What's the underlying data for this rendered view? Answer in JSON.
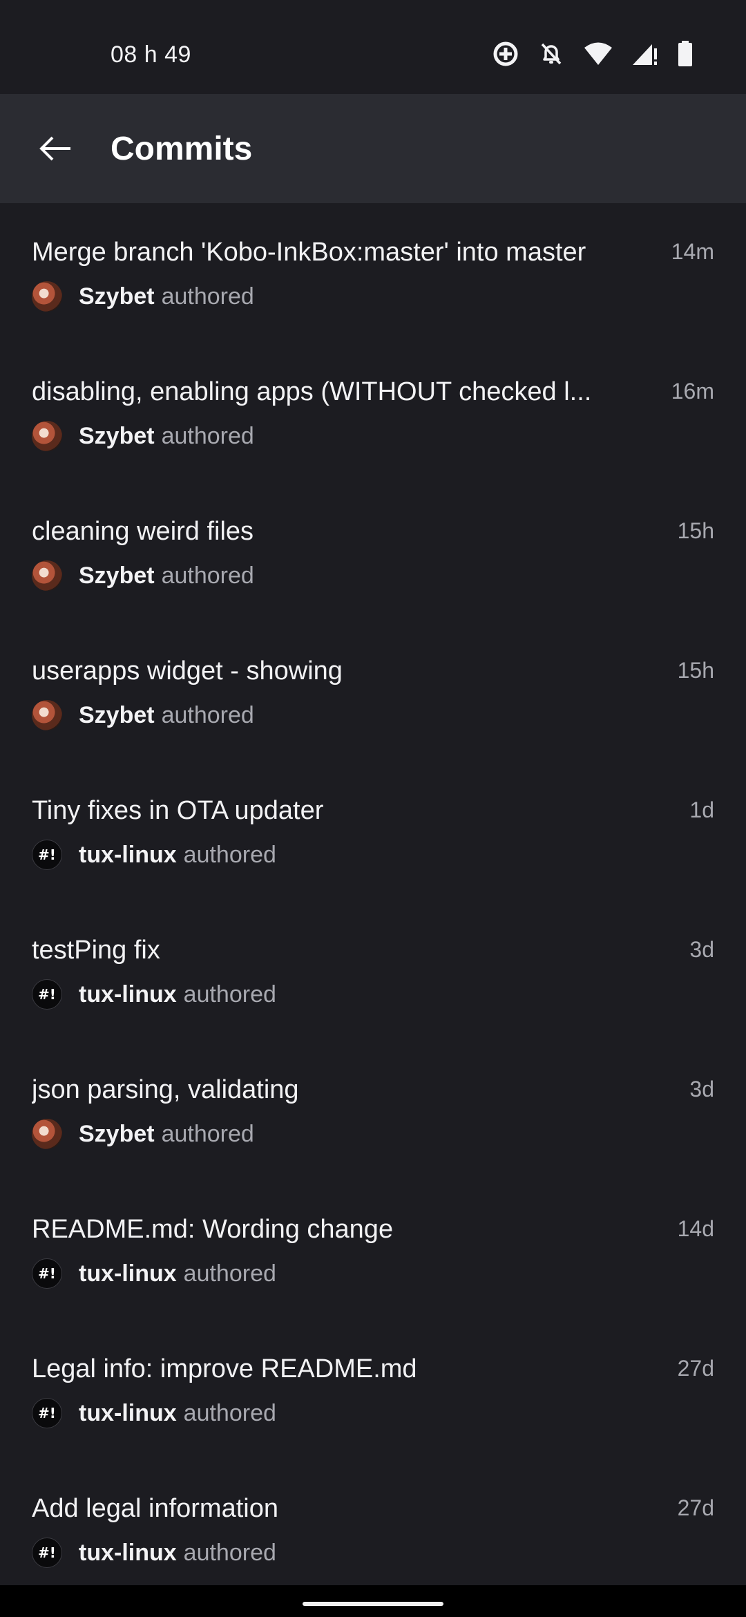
{
  "status": {
    "time": "08 h 49"
  },
  "appbar": {
    "title": "Commits"
  },
  "commits": [
    {
      "title": "Merge branch 'Kobo-InkBox:master' into master",
      "time": "14m",
      "author": "Szybet",
      "verb": "authored",
      "avatar": "panda-avatar"
    },
    {
      "title": "disabling, enabling apps (WITHOUT checked l...",
      "time": "16m",
      "author": "Szybet",
      "verb": "authored",
      "avatar": "panda-avatar"
    },
    {
      "title": "cleaning weird files",
      "time": "15h",
      "author": "Szybet",
      "verb": "authored",
      "avatar": "panda-avatar"
    },
    {
      "title": "userapps widget - showing",
      "time": "15h",
      "author": "Szybet",
      "verb": "authored",
      "avatar": "panda-avatar"
    },
    {
      "title": "Tiny fixes in OTA updater",
      "time": "1d",
      "author": "tux-linux",
      "verb": "authored",
      "avatar": "tux-avatar",
      "avatar_text": "#!"
    },
    {
      "title": "testPing fix",
      "time": "3d",
      "author": "tux-linux",
      "verb": "authored",
      "avatar": "tux-avatar",
      "avatar_text": "#!"
    },
    {
      "title": "json parsing, validating",
      "time": "3d",
      "author": "Szybet",
      "verb": "authored",
      "avatar": "panda-avatar"
    },
    {
      "title": "README.md: Wording change",
      "time": "14d",
      "author": "tux-linux",
      "verb": "authored",
      "avatar": "tux-avatar",
      "avatar_text": "#!"
    },
    {
      "title": "Legal info: improve README.md",
      "time": "27d",
      "author": "tux-linux",
      "verb": "authored",
      "avatar": "tux-avatar",
      "avatar_text": "#!"
    },
    {
      "title": "Add legal information",
      "time": "27d",
      "author": "tux-linux",
      "verb": "authored",
      "avatar": "tux-avatar",
      "avatar_text": "#!"
    }
  ],
  "colors": {
    "background": "#1c1c21",
    "appbar": "#2b2c32",
    "text_primary": "#f2f2f4",
    "text_secondary": "#a8a9b0"
  }
}
